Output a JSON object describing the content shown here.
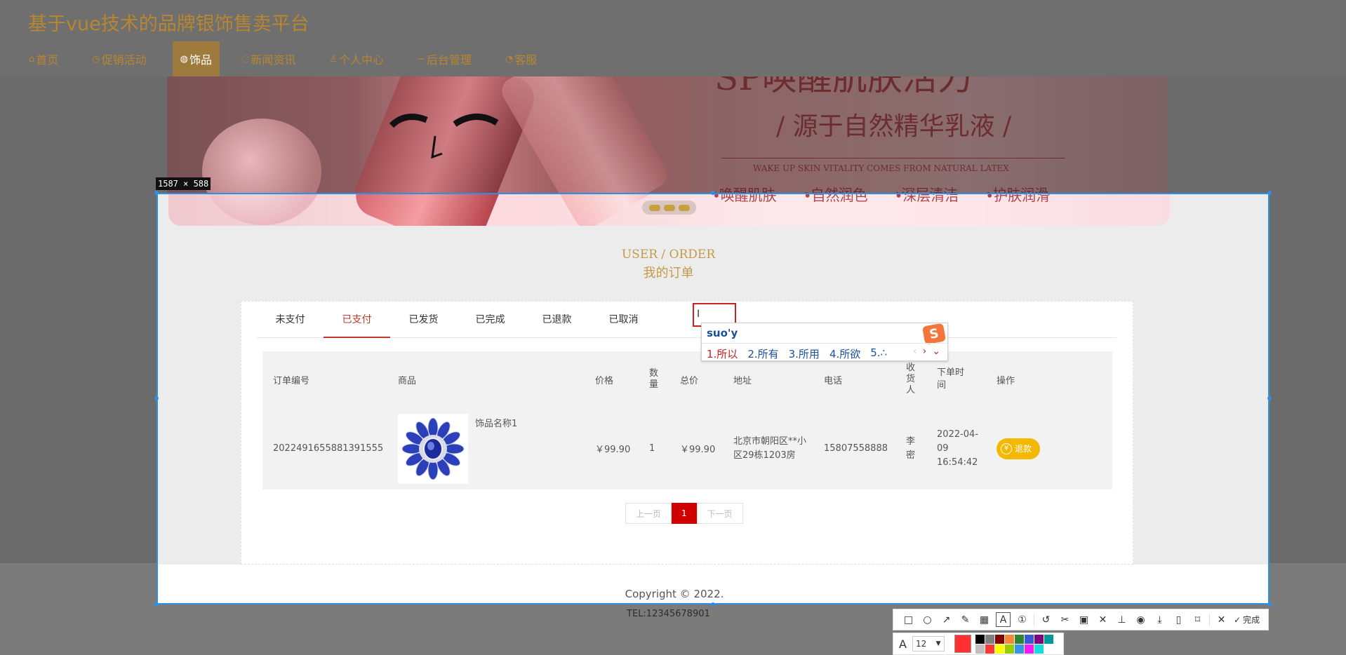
{
  "header": {
    "site_title": "基于vue技术的品牌银饰售卖平台",
    "nav": [
      {
        "icon": "home-icon",
        "glyph": "⌂",
        "label": "首页"
      },
      {
        "icon": "clock-icon",
        "glyph": "◷",
        "label": "促销活动"
      },
      {
        "icon": "gem-icon",
        "glyph": "◍",
        "label": "饰品"
      },
      {
        "icon": "news-icon",
        "glyph": "◌",
        "label": "新闻资讯"
      },
      {
        "icon": "user-icon",
        "glyph": "♙",
        "label": "个人中心"
      },
      {
        "icon": "link-icon",
        "glyph": "∽",
        "label": "后台管理"
      },
      {
        "icon": "service-icon",
        "glyph": "◔",
        "label": "客服"
      }
    ],
    "active_nav_index": 2
  },
  "banner": {
    "headline": "SP唤醒肌肤活力",
    "subline": "/ 源于自然精华乳液 /",
    "small": "WAKE UP SKIN VITALITY COMES FROM NATURAL LATEX",
    "tags": [
      "•唤醒肌肤",
      "•自然润色",
      "•深层清洁",
      "•护肤润滑"
    ]
  },
  "section": {
    "title_en": "USER / ORDER",
    "title_cn": "我的订单"
  },
  "tabs": [
    {
      "label": "未支付"
    },
    {
      "label": "已支付"
    },
    {
      "label": "已发货"
    },
    {
      "label": "已完成"
    },
    {
      "label": "已退款"
    },
    {
      "label": "已取消"
    }
  ],
  "active_tab_index": 1,
  "table": {
    "headers": {
      "order_no": "订单编号",
      "product": "商品",
      "price": "价格",
      "qty": "数量",
      "total": "总价",
      "address": "地址",
      "phone": "电话",
      "receiver": "收货人",
      "time": "下单时间",
      "action": "操作"
    },
    "rows": [
      {
        "order_no": "2022491655881391555",
        "product_name": "饰品名称1",
        "price": "￥99.90",
        "qty": "1",
        "total": "￥99.90",
        "address": "北京市朝阳区**小区29栋1203房",
        "phone": "15807558888",
        "receiver": "李密",
        "time": "2022-04-09 16:54:42",
        "action": "退款"
      }
    ]
  },
  "pager": {
    "prev": "上一页",
    "current": "1",
    "next": "下一页"
  },
  "footer": {
    "copyright": "Copyright © 2022.",
    "tel": "TEL:12345678901"
  },
  "ime": {
    "input": "suo'y",
    "candidates": [
      "1.所以",
      "2.所有",
      "3.所用",
      "4.所欲",
      "5.∴"
    ],
    "logo": "S"
  },
  "screenshot_tool": {
    "size_label": "1587 × 588",
    "done_label": "完成",
    "font_size": "12",
    "current_color": "#ff3030",
    "palette": [
      "#000000",
      "#808080",
      "#800000",
      "#f7883a",
      "#308430",
      "#385ad3",
      "#800080",
      "#009999",
      "#ffffff",
      "#c0c0c0",
      "#fb3838",
      "#ffff00",
      "#99cc00",
      "#3894e4",
      "#f31bf3",
      "#16dcdc"
    ]
  }
}
